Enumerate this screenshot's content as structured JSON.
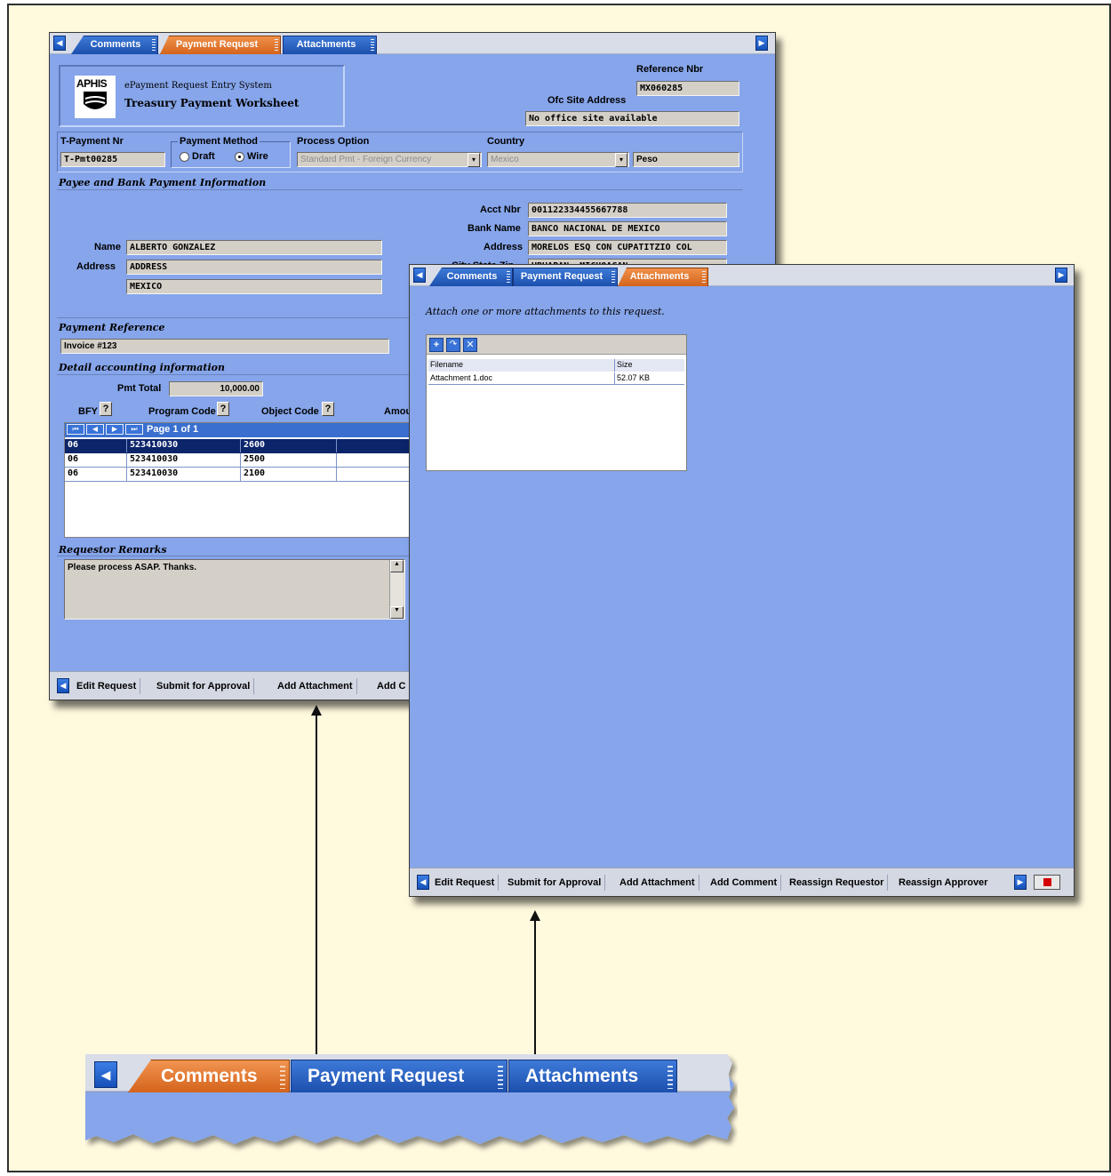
{
  "tabs": {
    "comments": "Comments",
    "payment_request": "Payment Request",
    "attachments": "Attachments"
  },
  "window_main": {
    "brand_logo_text": "APHIS",
    "subtitle": "ePayment Request Entry System",
    "title": "Treasury Payment Worksheet",
    "reference_nbr_label": "Reference Nbr",
    "reference_nbr_value": "MX060285",
    "ofc_site_label": "Ofc Site Address",
    "ofc_site_value": "No office site available",
    "tpayment_label": "T-Payment Nr",
    "tpayment_value": "T-Pmt00285",
    "payment_method_label": "Payment Method",
    "method_draft": "Draft",
    "method_wire": "Wire",
    "process_option_label": "Process Option",
    "process_option_value": "Standard Pmt - Foreign Currency",
    "country_label": "Country",
    "country_value": "Mexico",
    "currency_value": "Peso",
    "payee_section": "Payee and Bank Payment Information",
    "acct_nbr_label": "Acct Nbr",
    "acct_nbr_value": "001122334455667788",
    "bank_name_label": "Bank Name",
    "bank_name_value": "BANCO NACIONAL DE MEXICO",
    "bank_address_label": "Address",
    "bank_address_value": "MORELOS ESQ CON CUPATITZIO COL",
    "city_label_partial": "City State Zip",
    "city_value_partial": "URUAPAN, MICHOACAN",
    "name_label": "Name",
    "name_value": "ALBERTO GONZALEZ",
    "address_label": "Address",
    "address_line1": "ADDRESS",
    "address_line2": "MEXICO",
    "payment_reference_section": "Payment Reference",
    "payment_reference_value": "Invoice #123",
    "detail_section": "Detail accounting information",
    "pmt_total_label": "Pmt Total",
    "pmt_total_value": "10,000.00",
    "bfy_label": "BFY",
    "program_code_label": "Program Code",
    "object_code_label": "Object Code",
    "amount_label_partial": "Amou",
    "help_btn": "?",
    "page_text": "Page 1 of 1",
    "rows": [
      {
        "bfy": "06",
        "program": "523410030",
        "object": "2600"
      },
      {
        "bfy": "06",
        "program": "523410030",
        "object": "2500"
      },
      {
        "bfy": "06",
        "program": "523410030",
        "object": "2100"
      }
    ],
    "remarks_section": "Requestor Remarks",
    "remarks_value": "Please process ASAP.  Thanks."
  },
  "window_attach": {
    "instruction": "Attach one or more attachments to this request.",
    "col_filename": "Filename",
    "col_size": "Size",
    "files": [
      {
        "name": "Attachment 1.doc",
        "size": "52.07 KB"
      }
    ]
  },
  "toolbar": {
    "edit_request": "Edit Request",
    "submit_for_approval": "Submit for Approval",
    "add_attachment": "Add Attachment",
    "add_comment": "Add Comment",
    "add_comment_partial": "Add C",
    "reassign_requestor": "Reassign Requestor",
    "reassign_approver": "Reassign Approver"
  },
  "colors": {
    "panel_blue": "#86a5ea",
    "tab_blue": "#1c4fad",
    "tab_orange": "#d4641c",
    "background": "#fff9de"
  }
}
